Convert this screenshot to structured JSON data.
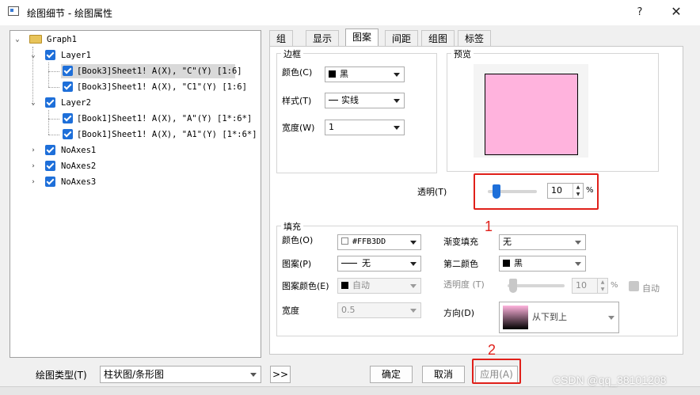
{
  "window": {
    "title": "绘图细节 - 绘图属性",
    "help": "?",
    "close": "✕"
  },
  "tree": {
    "root": "Graph1",
    "items": [
      {
        "label": "Layer1"
      },
      {
        "label": "[Book3]Sheet1! A(X), \"C\"(Y) [1:6]"
      },
      {
        "label": "[Book3]Sheet1! A(X), \"C1\"(Y) [1:6]"
      },
      {
        "label": "Layer2"
      },
      {
        "label": "[Book1]Sheet1! A(X), \"A\"(Y) [1*:6*]"
      },
      {
        "label": "[Book1]Sheet1! A(X), \"A1\"(Y) [1*:6*]"
      },
      {
        "label": "NoAxes1"
      },
      {
        "label": "NoAxes2"
      },
      {
        "label": "NoAxes3"
      }
    ]
  },
  "tabs": [
    "组",
    "显示",
    "图案",
    "间距",
    "组图",
    "标签"
  ],
  "border": {
    "title": "边框",
    "color_label": "颜色(C)",
    "color_value": "黑",
    "style_label": "样式(T)",
    "style_value": "实线",
    "width_label": "宽度(W)",
    "width_value": "1"
  },
  "preview": {
    "title": "预览",
    "fill_color": "#FFB3DD"
  },
  "transparency": {
    "label": "透明(T)",
    "value": "10",
    "unit": "%",
    "fraction": 0.1
  },
  "fill": {
    "title": "填充",
    "color_label": "颜色(O)",
    "color_value": "#FFB3DD",
    "pattern_label": "图案(P)",
    "pattern_value": "无",
    "pattern_color_label": "图案颜色(E)",
    "pattern_color_value": "自动",
    "width_label": "宽度",
    "width_value": "0.5",
    "gradient_label": "渐变填充",
    "gradient_value": "无",
    "second_color_label": "第二颜色",
    "second_color_value": "黑",
    "transparency_label": "透明度 (T)",
    "transparency_value": "10",
    "transparency_unit": "%",
    "auto_label": "自动",
    "direction_label": "方向(D)",
    "direction_value": "从下到上"
  },
  "footer": {
    "plot_type_label": "绘图类型(T)",
    "plot_type_value": "柱状图/条形图",
    "expand": ">>",
    "ok": "确定",
    "cancel": "取消",
    "apply": "应用(A)"
  },
  "annotations": {
    "one": "1",
    "two": "2"
  },
  "watermark": "CSDN @qq_38101208"
}
